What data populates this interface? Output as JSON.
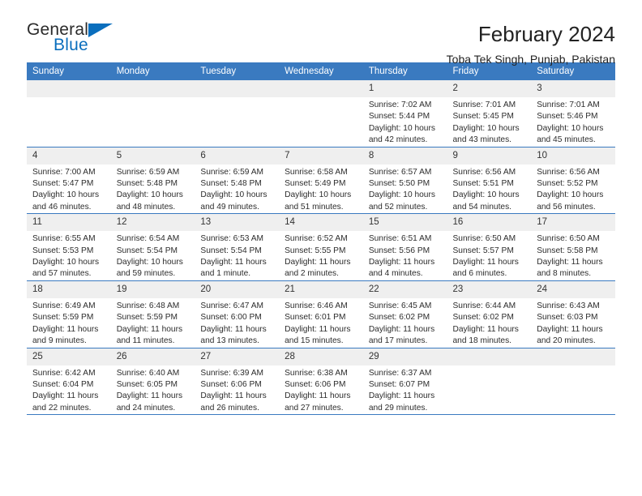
{
  "brand": {
    "name_top": "General",
    "name_bottom": "Blue",
    "accent_color": "#0a6ebd",
    "triangle_icon": "triangle-icon"
  },
  "header": {
    "title": "February 2024",
    "subtitle": "Toba Tek Singh, Punjab, Pakistan"
  },
  "theme": {
    "header_row_bg": "#3a7ac0",
    "header_row_text": "#ffffff",
    "daynum_bg": "#efefef",
    "grid_line": "#3a7ac0",
    "body_text": "#2c2c2c"
  },
  "weekdays": [
    "Sunday",
    "Monday",
    "Tuesday",
    "Wednesday",
    "Thursday",
    "Friday",
    "Saturday"
  ],
  "weeks": [
    [
      {
        "day": "",
        "empty": true
      },
      {
        "day": "",
        "empty": true
      },
      {
        "day": "",
        "empty": true
      },
      {
        "day": "",
        "empty": true
      },
      {
        "day": "1",
        "sunrise": "Sunrise: 7:02 AM",
        "sunset": "Sunset: 5:44 PM",
        "daylight": "Daylight: 10 hours and 42 minutes."
      },
      {
        "day": "2",
        "sunrise": "Sunrise: 7:01 AM",
        "sunset": "Sunset: 5:45 PM",
        "daylight": "Daylight: 10 hours and 43 minutes."
      },
      {
        "day": "3",
        "sunrise": "Sunrise: 7:01 AM",
        "sunset": "Sunset: 5:46 PM",
        "daylight": "Daylight: 10 hours and 45 minutes."
      }
    ],
    [
      {
        "day": "4",
        "sunrise": "Sunrise: 7:00 AM",
        "sunset": "Sunset: 5:47 PM",
        "daylight": "Daylight: 10 hours and 46 minutes."
      },
      {
        "day": "5",
        "sunrise": "Sunrise: 6:59 AM",
        "sunset": "Sunset: 5:48 PM",
        "daylight": "Daylight: 10 hours and 48 minutes."
      },
      {
        "day": "6",
        "sunrise": "Sunrise: 6:59 AM",
        "sunset": "Sunset: 5:48 PM",
        "daylight": "Daylight: 10 hours and 49 minutes."
      },
      {
        "day": "7",
        "sunrise": "Sunrise: 6:58 AM",
        "sunset": "Sunset: 5:49 PM",
        "daylight": "Daylight: 10 hours and 51 minutes."
      },
      {
        "day": "8",
        "sunrise": "Sunrise: 6:57 AM",
        "sunset": "Sunset: 5:50 PM",
        "daylight": "Daylight: 10 hours and 52 minutes."
      },
      {
        "day": "9",
        "sunrise": "Sunrise: 6:56 AM",
        "sunset": "Sunset: 5:51 PM",
        "daylight": "Daylight: 10 hours and 54 minutes."
      },
      {
        "day": "10",
        "sunrise": "Sunrise: 6:56 AM",
        "sunset": "Sunset: 5:52 PM",
        "daylight": "Daylight: 10 hours and 56 minutes."
      }
    ],
    [
      {
        "day": "11",
        "sunrise": "Sunrise: 6:55 AM",
        "sunset": "Sunset: 5:53 PM",
        "daylight": "Daylight: 10 hours and 57 minutes."
      },
      {
        "day": "12",
        "sunrise": "Sunrise: 6:54 AM",
        "sunset": "Sunset: 5:54 PM",
        "daylight": "Daylight: 10 hours and 59 minutes."
      },
      {
        "day": "13",
        "sunrise": "Sunrise: 6:53 AM",
        "sunset": "Sunset: 5:54 PM",
        "daylight": "Daylight: 11 hours and 1 minute."
      },
      {
        "day": "14",
        "sunrise": "Sunrise: 6:52 AM",
        "sunset": "Sunset: 5:55 PM",
        "daylight": "Daylight: 11 hours and 2 minutes."
      },
      {
        "day": "15",
        "sunrise": "Sunrise: 6:51 AM",
        "sunset": "Sunset: 5:56 PM",
        "daylight": "Daylight: 11 hours and 4 minutes."
      },
      {
        "day": "16",
        "sunrise": "Sunrise: 6:50 AM",
        "sunset": "Sunset: 5:57 PM",
        "daylight": "Daylight: 11 hours and 6 minutes."
      },
      {
        "day": "17",
        "sunrise": "Sunrise: 6:50 AM",
        "sunset": "Sunset: 5:58 PM",
        "daylight": "Daylight: 11 hours and 8 minutes."
      }
    ],
    [
      {
        "day": "18",
        "sunrise": "Sunrise: 6:49 AM",
        "sunset": "Sunset: 5:59 PM",
        "daylight": "Daylight: 11 hours and 9 minutes."
      },
      {
        "day": "19",
        "sunrise": "Sunrise: 6:48 AM",
        "sunset": "Sunset: 5:59 PM",
        "daylight": "Daylight: 11 hours and 11 minutes."
      },
      {
        "day": "20",
        "sunrise": "Sunrise: 6:47 AM",
        "sunset": "Sunset: 6:00 PM",
        "daylight": "Daylight: 11 hours and 13 minutes."
      },
      {
        "day": "21",
        "sunrise": "Sunrise: 6:46 AM",
        "sunset": "Sunset: 6:01 PM",
        "daylight": "Daylight: 11 hours and 15 minutes."
      },
      {
        "day": "22",
        "sunrise": "Sunrise: 6:45 AM",
        "sunset": "Sunset: 6:02 PM",
        "daylight": "Daylight: 11 hours and 17 minutes."
      },
      {
        "day": "23",
        "sunrise": "Sunrise: 6:44 AM",
        "sunset": "Sunset: 6:02 PM",
        "daylight": "Daylight: 11 hours and 18 minutes."
      },
      {
        "day": "24",
        "sunrise": "Sunrise: 6:43 AM",
        "sunset": "Sunset: 6:03 PM",
        "daylight": "Daylight: 11 hours and 20 minutes."
      }
    ],
    [
      {
        "day": "25",
        "sunrise": "Sunrise: 6:42 AM",
        "sunset": "Sunset: 6:04 PM",
        "daylight": "Daylight: 11 hours and 22 minutes."
      },
      {
        "day": "26",
        "sunrise": "Sunrise: 6:40 AM",
        "sunset": "Sunset: 6:05 PM",
        "daylight": "Daylight: 11 hours and 24 minutes."
      },
      {
        "day": "27",
        "sunrise": "Sunrise: 6:39 AM",
        "sunset": "Sunset: 6:06 PM",
        "daylight": "Daylight: 11 hours and 26 minutes."
      },
      {
        "day": "28",
        "sunrise": "Sunrise: 6:38 AM",
        "sunset": "Sunset: 6:06 PM",
        "daylight": "Daylight: 11 hours and 27 minutes."
      },
      {
        "day": "29",
        "sunrise": "Sunrise: 6:37 AM",
        "sunset": "Sunset: 6:07 PM",
        "daylight": "Daylight: 11 hours and 29 minutes."
      },
      {
        "day": "",
        "empty": true
      },
      {
        "day": "",
        "empty": true
      }
    ]
  ]
}
